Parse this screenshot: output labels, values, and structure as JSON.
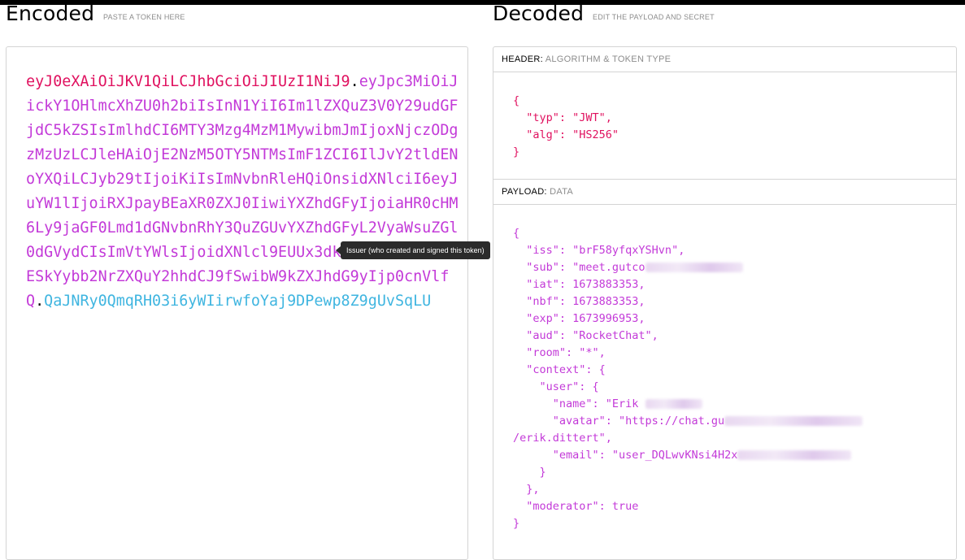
{
  "encoded": {
    "title": "Encoded",
    "subtitle": "PASTE A TOKEN HERE",
    "token_header": "eyJ0eXAiOiJKV1QiLCJhbGciOiJIUzI1NiJ9",
    "token_payload": "eyJpc3MiOiJickY1OHlmcXhZU0h2biIsInN1YiI6Im1lZXQuZ3V0Y29udGFjdC5kZSIsImlhdCI6MTY3Mzg4MzM1MywibmJmIjoxNjczODgzMzUzLCJleHAiOjE2NzM5OTY5NTMsImF1ZCI6IlJvY2tldENoYXQiLCJyb29tIjoiKiIsImNvbnRleHQiOnsidXNlciI6eyJuYW1lIjoiRXJpayBEaXR0ZXJ0IiwiYXZhdGFyIjoiaHR0cHM6Ly9jaGF0Lmd1dGNvbnRhY3QuZGUvYXZhdGFyL2VyaWsuZGl0dGVydCIsImVtYWlsIjoidXNlcl9EUUx3dktOc2k0SDJ4SmtESkYybb2NrZXQuY2hhdCJ9fSwibW9kZXJhdG9yIjp0cnVlfQ",
    "dot": ".",
    "token_signature": "QaJNRy0QmqRH03i6yWIirwfoYaj9DPewp8Z9gUvSqLU"
  },
  "decoded": {
    "title": "Decoded",
    "subtitle": "EDIT THE PAYLOAD AND SECRET",
    "header_section": {
      "label": "HEADER:",
      "sublabel": "ALGORITHM & TOKEN TYPE"
    },
    "payload_section": {
      "label": "PAYLOAD:",
      "sublabel": "DATA"
    },
    "header_json": {
      "open": "{",
      "typ_line": "  \"typ\": \"JWT\",",
      "alg_line": "  \"alg\": \"HS256\"",
      "close": "}"
    },
    "payload_json": {
      "open": "{",
      "iss": "  \"iss\": \"brF58yfqxYSHvn\",",
      "sub": "  \"sub\": \"meet.gutco",
      "iat": "  \"iat\": 1673883353,",
      "nbf": "  \"nbf\": 1673883353,",
      "exp": "  \"exp\": 1673996953,",
      "aud": "  \"aud\": \"RocketChat\",",
      "room": "  \"room\": \"*\",",
      "context": "  \"context\": {",
      "user": "    \"user\": {",
      "name": "      \"name\": \"Erik ",
      "avatar": "      \"avatar\": \"https://chat.gu",
      "avatar_cont": "/erik.dittert\",",
      "email": "      \"email\": \"user_DQLwvKNsi4H2x",
      "user_close": "    }",
      "context_close": "  },",
      "moderator": "  \"moderator\": true",
      "close": "}"
    }
  },
  "tooltip": {
    "text": "Issuer (who created and signed this token)"
  }
}
